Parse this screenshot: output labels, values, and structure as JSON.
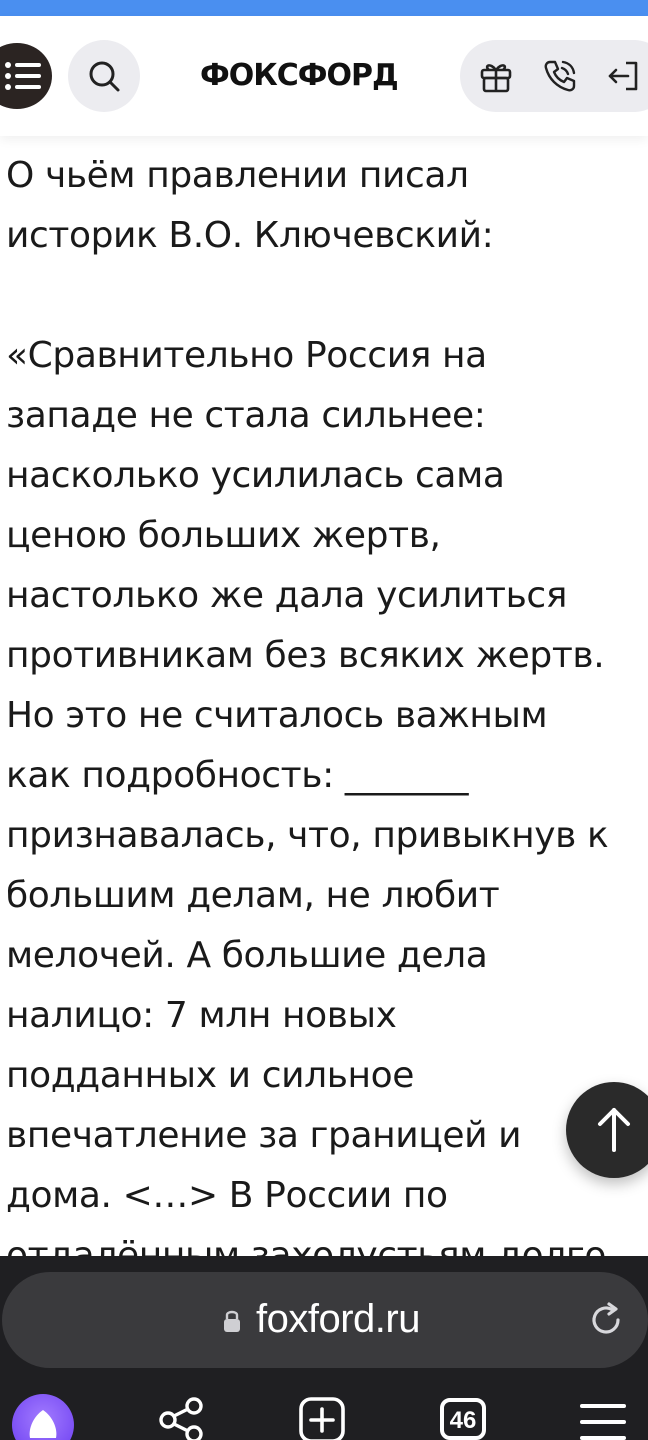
{
  "header": {
    "logo_text": "ФОКСФОРД",
    "icons": {
      "menu": "menu-icon",
      "search": "search-icon",
      "gift": "gift-icon",
      "phone": "phone-icon",
      "login": "login-icon"
    }
  },
  "article": {
    "question_line1": "О чьём правлении писал",
    "question_line2": "историк В.О. Ключевский:",
    "quote_lines": [
      "«Сравнительно Россия на",
      "западе не стала сильнее:",
      "насколько усилилась сама",
      "ценою больших жертв,",
      "настолько же дала усилиться",
      "противникам без всяких жертв.",
      "Но это не считалось важным",
      "как подробность: _______",
      "признавалась, что, привыкнув к",
      "большим делам, не любит",
      "мелочей. А большие дела",
      "налицо: 7 млн новых",
      "подданных и сильное",
      "впечатление за границей и",
      "дома. <…> В России по",
      "отдалённым захолустьям долго"
    ]
  },
  "fab": {
    "icon": "arrow-up-icon"
  },
  "browser": {
    "url": "foxford.ru",
    "tabs_count": "46",
    "icons": {
      "lock": "lock-icon",
      "reload": "reload-icon",
      "alice": "alice-assistant-icon",
      "share": "share-icon",
      "new_tab": "new-tab-icon",
      "tabs": "tabs-icon",
      "menu": "browser-menu-icon"
    }
  },
  "colors": {
    "accent_top": "#4a8ff0",
    "header_dark_button": "#2b2422",
    "pill_bg": "#ececf0",
    "browser_bg": "#1f1f22",
    "url_field_bg": "#3a3a3d",
    "alice_purple": "#7b4dff"
  }
}
